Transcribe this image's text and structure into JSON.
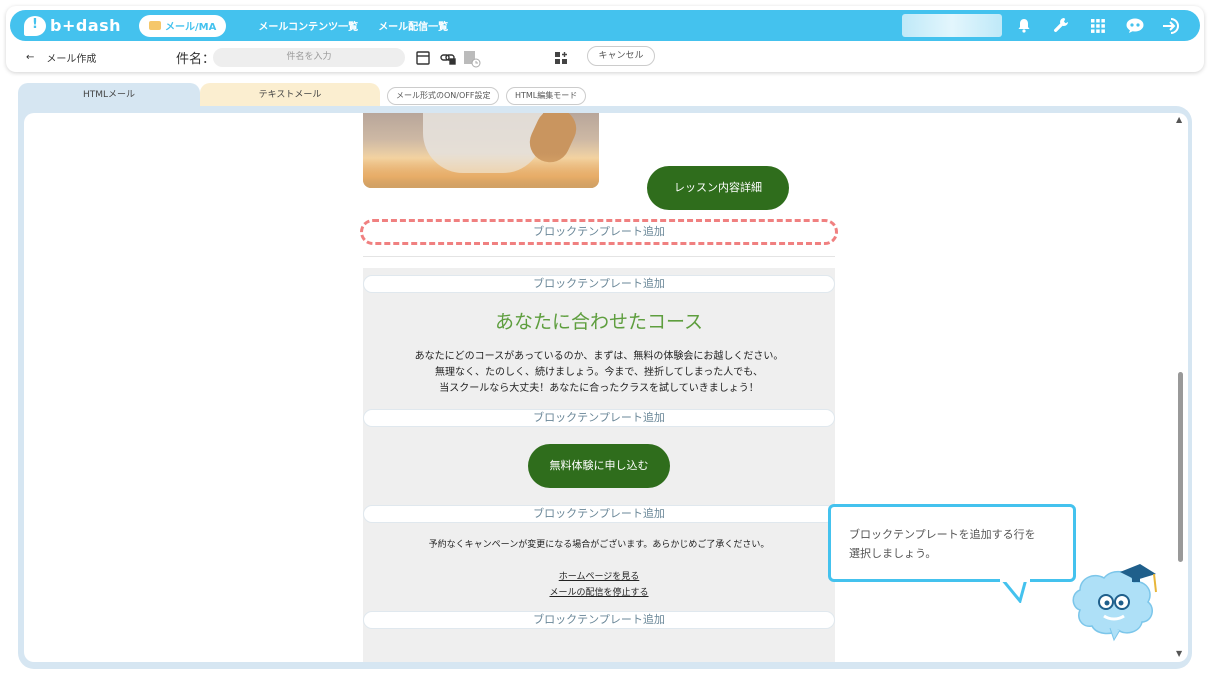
{
  "header": {
    "logo": "b+dash",
    "mail_pill": "メール/MA",
    "nav": [
      "メールコンテンツ一覧",
      "メール配信一覧"
    ],
    "icons": [
      "bell-icon",
      "wrench-icon",
      "grid-icon",
      "chat-robot-icon",
      "logout-icon"
    ]
  },
  "toolbar": {
    "back_label": "メール作成",
    "subject_label": "件名：",
    "subject_placeholder": "件名を入力",
    "cancel_label": "キャンセル"
  },
  "tabs": {
    "html": "HTMLメール",
    "text": "テキストメール",
    "format_toggle": "メール形式のON/OFF設定",
    "html_edit": "HTML編集モード"
  },
  "email": {
    "lesson_button": "レッスン内容詳細",
    "block_add": "ブロックテンプレート追加",
    "course_title": "あなたに合わせたコース",
    "course_lines": [
      "あなたにどのコースがあっているのか、まずは、無料の体験会にお越しください。",
      "無理なく、たのしく、続けましょう。今まで、挫折してしまった人でも、",
      "当スクールなら大丈夫！あなたに合ったクラスを試していきましょう！"
    ],
    "trial_button": "無料体験に申し込む",
    "notice": "予約なくキャンペーンが変更になる場合がございます。あらかじめご了承ください。",
    "homepage_link": "ホームページを見る",
    "unsubscribe_link": "メールの配信を停止する"
  },
  "tooltip": {
    "line1": "ブロックテンプレートを追加する行を",
    "line2": "選択しましょう。"
  },
  "colors": {
    "brand": "#44c2ee",
    "green_button": "#2f6d1c",
    "course_title": "#5e9e3e",
    "highlight": "#f08080"
  }
}
